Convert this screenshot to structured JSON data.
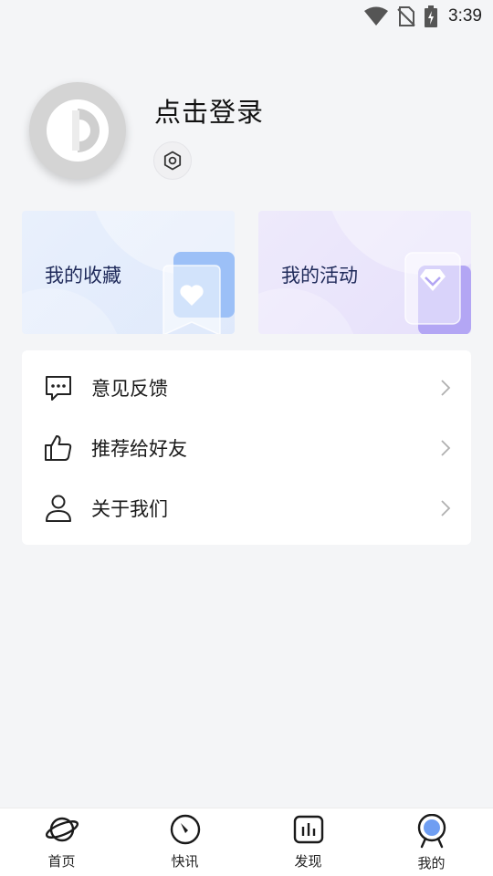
{
  "status_bar": {
    "time": "3:39",
    "icons": [
      "wifi-icon",
      "no-sim-icon",
      "battery-charging-icon"
    ]
  },
  "profile": {
    "login_label": "点击登录",
    "avatar_icon": "avatar-placeholder-icon",
    "settings_icon": "settings-gear-icon"
  },
  "cards": {
    "favorites": {
      "label": "我的收藏",
      "icon": "heart-icon",
      "accent": "#9cc0f7"
    },
    "activities": {
      "label": "我的活动",
      "icon": "diamond-icon",
      "accent": "#b3a6f4"
    }
  },
  "menu": {
    "items": [
      {
        "label": "意见反馈",
        "icon": "feedback-chat-icon"
      },
      {
        "label": "推荐给好友",
        "icon": "thumbs-up-icon"
      },
      {
        "label": "关于我们",
        "icon": "person-icon"
      }
    ]
  },
  "bottom_nav": {
    "items": [
      {
        "label": "首页",
        "icon": "planet-icon"
      },
      {
        "label": "快讯",
        "icon": "clock-icon"
      },
      {
        "label": "发现",
        "icon": "chart-icon"
      },
      {
        "label": "我的",
        "icon": "profile-icon",
        "active": true
      }
    ],
    "active_color": "#6f9ef2"
  }
}
